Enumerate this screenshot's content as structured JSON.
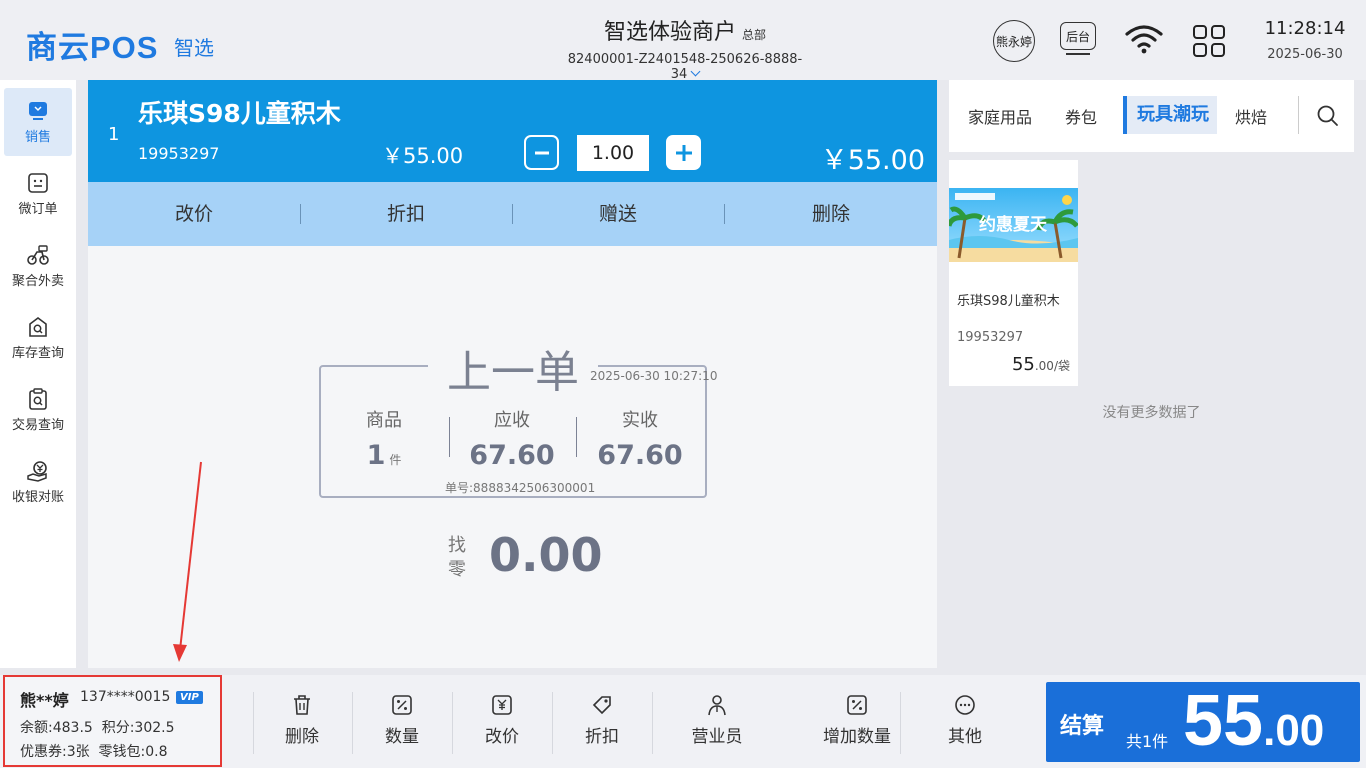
{
  "header": {
    "logo": "商云POS",
    "logo_sub": "智选",
    "merchant_name": "智选体验商户",
    "merchant_tag": "总部",
    "merchant_id": "82400001-Z2401548-250626-8888-34",
    "user_button": "熊永婷",
    "backend_button": "后台",
    "time": "11:28:14",
    "date": "2025-06-30"
  },
  "nav": [
    {
      "label": "销售",
      "icon": "sales-icon"
    },
    {
      "label": "微订单",
      "icon": "micro-order-icon"
    },
    {
      "label": "聚合外卖",
      "icon": "delivery-icon"
    },
    {
      "label": "库存查询",
      "icon": "stock-search-icon"
    },
    {
      "label": "交易查询",
      "icon": "transaction-search-icon"
    },
    {
      "label": "收银对账",
      "icon": "reconcile-icon"
    }
  ],
  "cart_item": {
    "index": "1",
    "name": "乐琪S98儿童积木",
    "code": "19953297",
    "unit_price": "￥55.00",
    "quantity": "1.00",
    "total": "￥55.00"
  },
  "item_actions": [
    "改价",
    "折扣",
    "赠送",
    "删除"
  ],
  "last_order": {
    "title": "上一单",
    "time": "2025-06-30 10:27:10",
    "goods_label": "商品",
    "goods_value": "1",
    "goods_unit": "件",
    "due_label": "应收",
    "due_value": "67.60",
    "paid_label": "实收",
    "paid_value": "67.60",
    "order_no": "单号:8888342506300001",
    "change_label": "找零",
    "change_value": "0.00"
  },
  "catalog": {
    "tabs": [
      "家庭用品",
      "券包",
      "玩具潮玩",
      "烘焙"
    ],
    "active_tab": "玩具潮玩",
    "banner_text": "约惠夏天",
    "product": {
      "name": "乐琪S98儿童积木",
      "code": "19953297",
      "price_int": "55",
      "price_unit": ".00/袋"
    },
    "no_more": "没有更多数据了"
  },
  "member": {
    "name": "熊**婷",
    "phone": "137****0015",
    "vip": "VIP",
    "balance": "余额:483.5",
    "points": "积分:302.5",
    "coupons": "优惠券:3张",
    "wallet": "零钱包:0.8"
  },
  "toolbar": [
    "删除",
    "数量",
    "改价",
    "折扣",
    "营业员",
    "增加数量",
    "其他"
  ],
  "checkout": {
    "label": "结算",
    "count": "共1件",
    "amount_int": "55",
    "amount_dec": ".00"
  },
  "colors": {
    "brand": "#1f7ae0",
    "item_row": "#0e95e0",
    "action_row": "#a6d2f7",
    "checkout": "#1a6fd9",
    "highlight": "#e53935"
  }
}
